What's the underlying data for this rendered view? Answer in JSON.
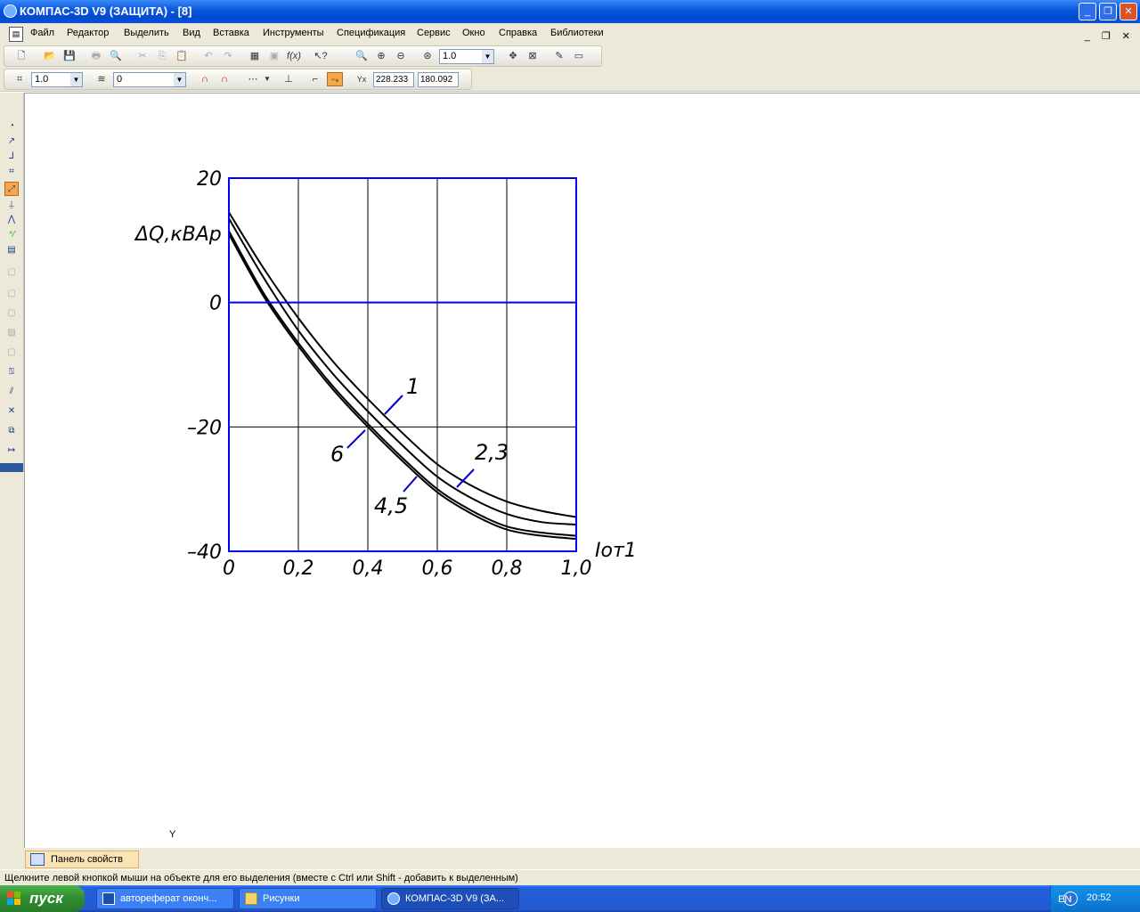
{
  "window": {
    "title": "КОМПАС-3D V9 (ЗАЩИТА) - [8]",
    "minimize_icon": "minimize-icon",
    "restore_icon": "restore-icon",
    "close_icon": "close-icon"
  },
  "menu": {
    "items": [
      "Файл",
      "Редактор",
      "Выделить",
      "Вид",
      "Вставка",
      "Инструменты",
      "Спецификация",
      "Сервис",
      "Окно",
      "Справка",
      "Библиотеки"
    ]
  },
  "toolbar": {
    "zoom_value": "1.0",
    "step_value": "1.0",
    "layer_value": "0",
    "coord_x": "228.233",
    "coord_y": "180.092"
  },
  "canvas": {
    "axis_y_marker": "Y"
  },
  "property_panel": {
    "tab_label": "Панель свойств"
  },
  "status": {
    "hint": "Щелкните левой кнопкой мыши на объекте для его выделения (вместе с Ctrl или Shift - добавить к выделенным)"
  },
  "taskbar": {
    "start_label": "пуск",
    "buttons": [
      "автореферат оконч...",
      "Рисунки",
      "КОМПАС-3D V9 (ЗА..."
    ],
    "language": "EN",
    "clock": "20:52"
  },
  "chart_data": {
    "type": "line",
    "ylabel": "ΔQ,кВАр",
    "xlabel": "Iот1",
    "xlim": [
      0,
      1.0
    ],
    "ylim": [
      -40,
      20
    ],
    "x_ticks": [
      "0",
      "0,2",
      "0,4",
      "0,6",
      "0,8",
      "1,0"
    ],
    "y_ticks": [
      "20",
      "0",
      "–20",
      "–40"
    ],
    "grid": true,
    "x": [
      0,
      0.1,
      0.2,
      0.3,
      0.4,
      0.5,
      0.6,
      0.7,
      0.8,
      0.9,
      1.0
    ],
    "series": [
      {
        "name": "1",
        "values": [
          14.5,
          5.5,
          -2.5,
          -9.5,
          -15.5,
          -21,
          -26,
          -29.5,
          -32,
          -33.5,
          -34.5
        ]
      },
      {
        "name": "2,3",
        "values": [
          13.5,
          4,
          -4.5,
          -11.5,
          -17.5,
          -23,
          -28,
          -31.5,
          -34,
          -35.3,
          -35.7
        ]
      },
      {
        "name": "4,5",
        "values": [
          11.5,
          1.5,
          -6.5,
          -13.5,
          -19.5,
          -25,
          -30,
          -33.5,
          -36,
          -37,
          -37.5
        ]
      },
      {
        "name": "6",
        "values": [
          11,
          1,
          -7,
          -14,
          -20,
          -25.5,
          -30.5,
          -34,
          -36.5,
          -37.5,
          -38
        ]
      }
    ],
    "colors": {
      "frame": "#0000ff",
      "zero_line": "#0000ff",
      "grid": "#000000",
      "curves": "#000000",
      "leaders": "#0000cc"
    }
  }
}
